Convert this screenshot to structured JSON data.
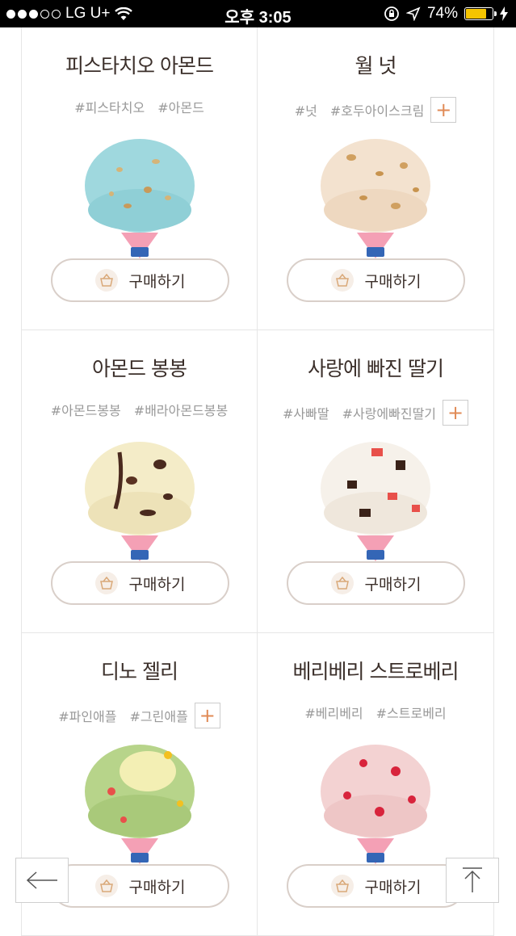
{
  "status_bar": {
    "carrier": "LG U+",
    "time": "오후 3:05",
    "battery": "74%"
  },
  "products": [
    {
      "name": "피스타치오 아몬드",
      "tags": [
        "#피스타치오",
        "#아몬드"
      ],
      "has_more": false,
      "buy_label": "구매하기"
    },
    {
      "name": "월 넛",
      "tags": [
        "#넛",
        "#호두아이스크림"
      ],
      "has_more": true,
      "buy_label": "구매하기"
    },
    {
      "name": "아몬드 봉봉",
      "tags": [
        "#아몬드봉봉",
        "#배라아몬드봉봉"
      ],
      "has_more": false,
      "buy_label": "구매하기"
    },
    {
      "name": "사랑에 빠진 딸기",
      "tags": [
        "#사빠딸",
        "#사랑에빠진딸기"
      ],
      "has_more": true,
      "buy_label": "구매하기"
    },
    {
      "name": "디노 젤리",
      "tags": [
        "#파인애플",
        "#그린애플"
      ],
      "has_more": true,
      "buy_label": "구매하기"
    },
    {
      "name": "베리베리 스트로베리",
      "tags": [
        "#베리베리",
        "#스트로베리"
      ],
      "has_more": false,
      "buy_label": "구매하기"
    }
  ],
  "more_tags_label": "+",
  "colors": {
    "accent": "#e08a55",
    "text": "#3b2f2a",
    "tag": "#999999",
    "border": "#d9cfc9"
  }
}
